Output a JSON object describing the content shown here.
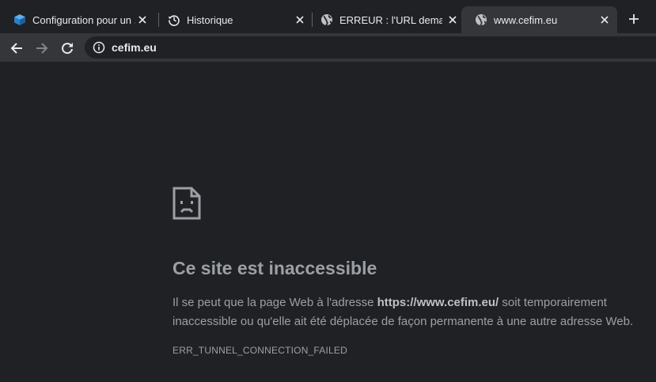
{
  "tabs": [
    {
      "label": "Configuration pour un ...",
      "favicon": "layers-icon",
      "active": false
    },
    {
      "label": "Historique",
      "favicon": "history-icon",
      "active": false
    },
    {
      "label": "ERREUR : l'URL demandée",
      "favicon": "globe-icon",
      "active": false
    },
    {
      "label": "www.cefim.eu",
      "favicon": "globe-icon",
      "active": true
    }
  ],
  "toolbar": {
    "url": "cefim.eu"
  },
  "error_page": {
    "heading": "Ce site est inaccessible",
    "desc_before": "Il se peut que la page Web à l'adresse ",
    "desc_host": "https://www.cefim.eu/",
    "desc_after": " soit temporairement inaccessible ou qu'elle ait été déplacée de façon permanente à une autre adresse Web.",
    "error_code": "ERR_TUNNEL_CONNECTION_FAILED"
  },
  "colors": {
    "background": "#202124",
    "toolbar": "#35363a",
    "text": "#9aa0a6",
    "tab_text": "#e8eaed"
  }
}
